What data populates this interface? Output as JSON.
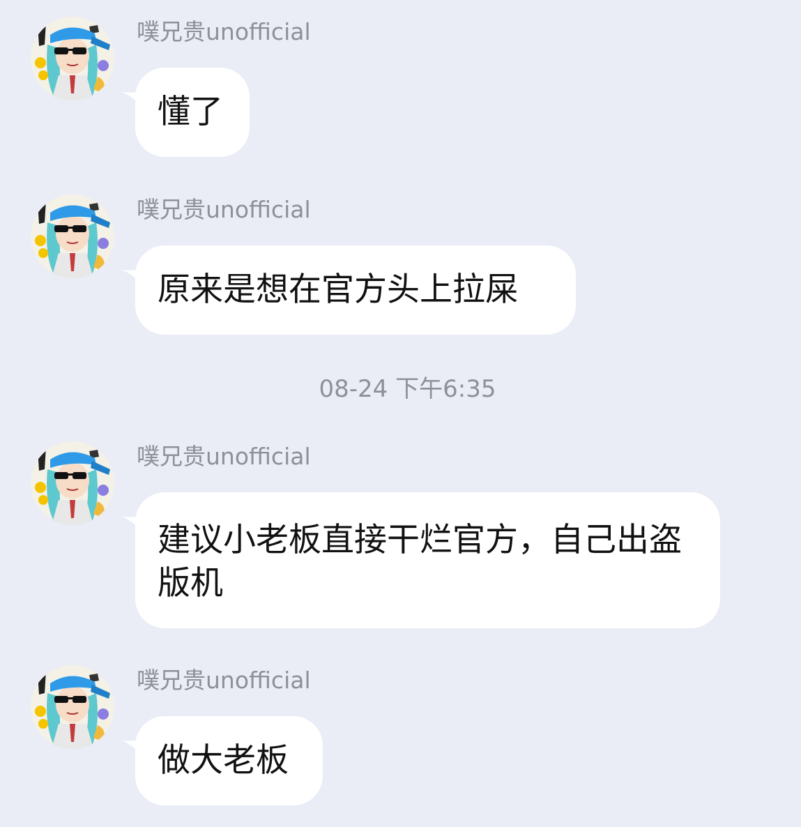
{
  "chat": {
    "timestamp": "08-24 下午6:35",
    "messages": [
      {
        "sender": "噗兄贵unofficial",
        "text": "懂了",
        "avatar_icon": "anime-avatar-icon"
      },
      {
        "sender": "噗兄贵unofficial",
        "text": "原来是想在官方头上拉屎",
        "avatar_icon": "anime-avatar-icon"
      },
      {
        "sender": "噗兄贵unofficial",
        "text": "建议小老板直接干烂官方，自己出盗版机",
        "avatar_icon": "anime-avatar-icon"
      },
      {
        "sender": "噗兄贵unofficial",
        "text": "做大老板",
        "avatar_icon": "anime-avatar-icon"
      }
    ]
  },
  "colors": {
    "background": "#eaecf6",
    "bubble": "#ffffff",
    "meta_text": "#8e8f99",
    "message_text": "#111111",
    "cap_blue": "#2f9be8",
    "hair_teal": "#5ec8cf"
  }
}
